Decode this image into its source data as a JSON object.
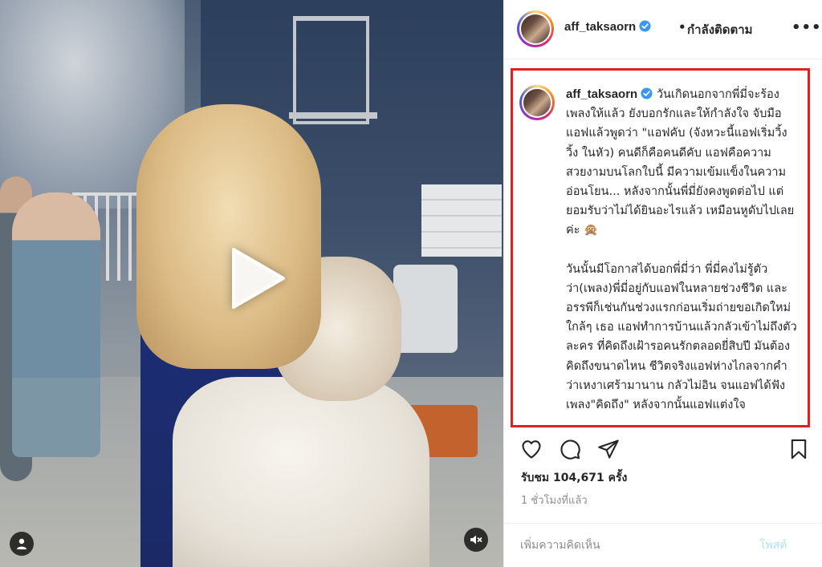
{
  "post": {
    "username": "aff_taksaorn",
    "dot": "•",
    "following_label": "กำลังติดตาม",
    "more_label": "•••",
    "caption_para1": "วันเกิดนอกจากพี่มี่จะร้องเพลงให้แล้ว ยังบอกรักและให้กำลังใจ จับมือแอฟแล้วพูดว่า \"แอฟคับ (จังหวะนี้แอฟเริ่มวิ้ง วิ้ง ในหัว) คนดีก็คือคนดีคับ แอฟคือความสวยงามบนโลกใบนี้ มีความเข้มแข็งในความอ่อนโยน... หลังจากนั้นพี่มี่ยังคงพูดต่อไป แต่ยอมรับว่าไม่ได้ยินอะไรแล้ว เหมือนหูดับไปเลยค่ะ 🙊",
    "caption_para2": "วันนั้นมีโอกาสได้บอกพี่มี่ว่า พี่มี่คงไม่รู้ตัวว่า(เพลง)พี่มี่อยู่กับแอฟในหลายช่วงชีวิต และอรรพีก็เช่นกันช่วงแรกก่อนเริ่มถ่ายขอเกิดใหม่ใกล้ๆ เธอ แอฟทำการบ้านแล้วกลัวเข้าไม่ถึงตัวละคร ที่คิดถึงเฝ้ารอคนรักตลอดยี่สิบปี มันต้องคิดถึงขนาดไหน ชีวิตจริงแอฟห่างไกลจากคำว่าเหงาเศร้ามานาน กลัวไม่อิน จนแอฟได้ฟังเพลง\"คิดถึง\" หลังจากนั้นแอฟแต่งใจ",
    "views": "รับชม 104,671 ครั้ง",
    "time_ago": "1 ชั่วโมงที่แล้ว",
    "comment_placeholder": "เพิ่มความคิดเห็น",
    "post_label": "โพสต์"
  },
  "icons": {
    "verified": "verified-badge-icon",
    "like": "heart-icon",
    "comment": "comment-bubble-icon",
    "share": "paper-plane-icon",
    "save": "bookmark-icon",
    "play": "play-icon",
    "user_tag": "user-tag-icon",
    "mute": "muted-speaker-icon"
  },
  "colors": {
    "highlight_border": "#e02020",
    "verified_blue": "#3897f0",
    "post_button_disabled": "#b2dffc",
    "secondary_text": "#8e8e8e"
  }
}
